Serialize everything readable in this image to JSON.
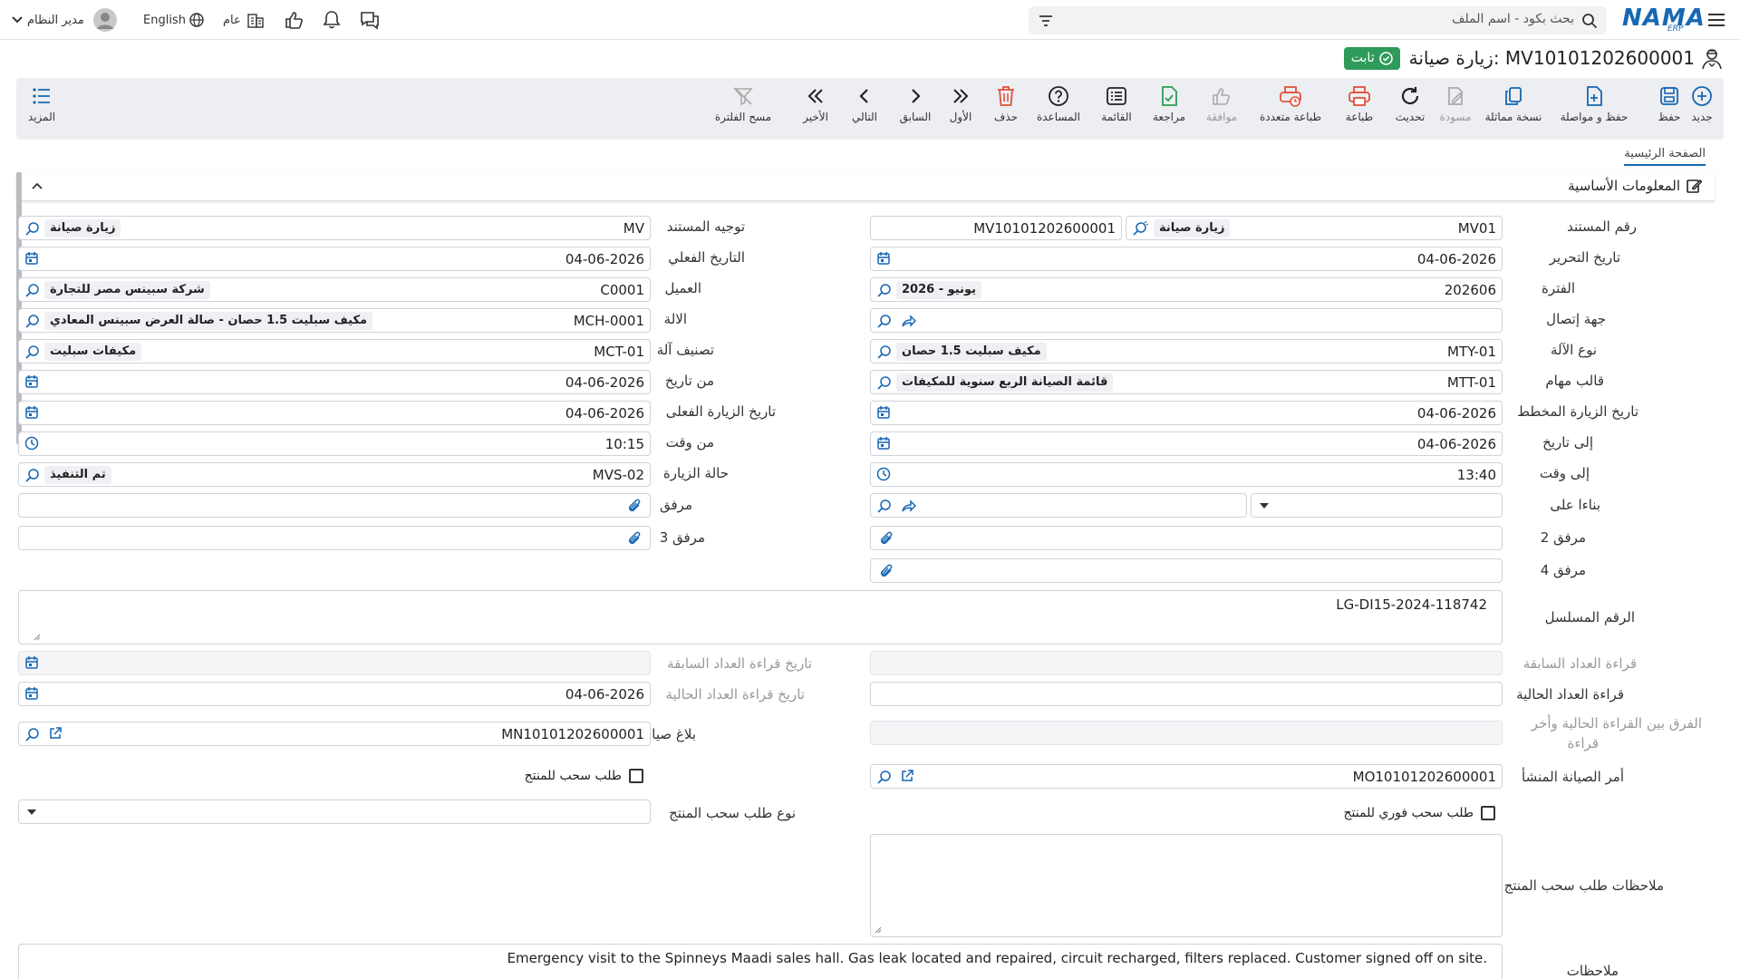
{
  "header": {
    "search_placeholder": "بحث بكود - اسم الملف",
    "user_name": "مدير النظام",
    "language": "English",
    "scope": "عام",
    "logo_text": "NAMA",
    "logo_sub": "ERP"
  },
  "page": {
    "title": "زيارة صيانة: MV10101202600001",
    "status": "ثابت",
    "tab": "الصفحة الرئيسية",
    "section_title": "المعلومات الأساسية"
  },
  "toolbar": {
    "buttons": [
      {
        "label": "جديد",
        "icon": "plus-circle-icon"
      },
      {
        "label": "حفظ",
        "icon": "save-icon"
      },
      {
        "label": "حفظ و مواصلة",
        "icon": "save-continue-icon"
      },
      {
        "label": "نسخة مماثلة",
        "icon": "duplicate-icon"
      },
      {
        "label": "مسودة",
        "icon": "draft-icon"
      },
      {
        "label": "تحديث",
        "icon": "refresh-icon"
      },
      {
        "label": "طباعة",
        "icon": "print-icon"
      },
      {
        "label": "طباعة متعددة",
        "icon": "multi-print-icon"
      },
      {
        "label": "موافقة",
        "icon": "thumbs-up-icon"
      },
      {
        "label": "مراجعة",
        "icon": "review-icon"
      },
      {
        "label": "القائمة",
        "icon": "list-icon"
      },
      {
        "label": "المساعدة",
        "icon": "help-icon"
      },
      {
        "label": "حذف",
        "icon": "trash-icon"
      },
      {
        "label": "الأول",
        "icon": "first-icon"
      },
      {
        "label": "السابق",
        "icon": "prev-icon"
      },
      {
        "label": "التالي",
        "icon": "next-icon"
      },
      {
        "label": "الأخير",
        "icon": "last-icon"
      },
      {
        "label": "مسح الفلترة",
        "icon": "clear-filter-icon"
      },
      {
        "label": "المزيد",
        "icon": "more-icon"
      }
    ]
  },
  "form": {
    "doc_number": {
      "label": "رقم المستند",
      "code": "MV01",
      "name": "زيارة صيانة",
      "serial": "MV10101202600001"
    },
    "doc_direction": {
      "label": "توجيه المستند",
      "code": "MV",
      "name": "زيارة صيانة"
    },
    "edit_date": {
      "label": "تاريخ التحرير",
      "value": "04-06-2026"
    },
    "actual_date": {
      "label": "التاريخ الفعلي",
      "value": "04-06-2026"
    },
    "period": {
      "label": "الفترة",
      "code": "202606",
      "name": "2026 - يونيو"
    },
    "customer": {
      "label": "العميل",
      "code": "C0001",
      "name": "شركة سبينس مصر للتجارة"
    },
    "contact": {
      "label": "جهة إتصال"
    },
    "machine": {
      "label": "الالة",
      "code": "MCH-0001",
      "name": "مكيف سبليت 1.5 حصان - صالة العرض سبينس المعادي"
    },
    "machine_type": {
      "label": "نوع الآلة",
      "code": "MTY-01",
      "name": "مكيف سبليت 1.5 حصان"
    },
    "machine_class": {
      "label": "تصنيف آلة",
      "code": "MCT-01",
      "name": "مكيفات سبليت"
    },
    "task_template": {
      "label": "قالب مهام",
      "code": "MTT-01",
      "name": "قائمة الصيانة الربع سنوية للمكيفات"
    },
    "from_date": {
      "label": "من تاريخ",
      "value": "04-06-2026"
    },
    "planned_visit_date": {
      "label": "تاريخ الزيارة المخطط",
      "value": "04-06-2026"
    },
    "actual_visit_date": {
      "label": "تاريخ الزيارة الفعلى",
      "value": "04-06-2026"
    },
    "to_date": {
      "label": "إلى تاريخ",
      "value": "04-06-2026"
    },
    "from_time": {
      "label": "من وقت",
      "value": "10:15"
    },
    "to_time": {
      "label": "إلى وقت",
      "value": "13:40"
    },
    "visit_status": {
      "label": "حالة الزيارة",
      "code": "MVS-02",
      "name": "تم التنفيذ"
    },
    "based_on": {
      "label": "بناءا على"
    },
    "attachment": {
      "label": "مرفق"
    },
    "attachment2": {
      "label": "مرفق 2"
    },
    "attachment3": {
      "label": "مرفق 3"
    },
    "attachment4": {
      "label": "مرفق 4"
    },
    "serial_number": {
      "label": "الرقم المسلسل",
      "value": "LG-DI15-2024-118742"
    },
    "prev_counter": {
      "label": "قراءة العداد السابقة"
    },
    "prev_counter_date": {
      "label": "تاريخ قراءة العداد السابقة"
    },
    "cur_counter": {
      "label": "قراءة العداد الحالية"
    },
    "cur_counter_date": {
      "label": "تاريخ قراءة العداد الحالية",
      "value": "04-06-2026"
    },
    "diff": {
      "label_line1": "الفرق بين القراءة الحالية وأخر",
      "label_line2": "قراءة"
    },
    "maintenance_report": {
      "label": "بلاغ صيانة",
      "value": "MN10101202600001"
    },
    "origin_order": {
      "label": "أمر الصيانة المنشأ",
      "value": "MO10101202600001"
    },
    "pull_request": {
      "label": "طلب سحب للمنتج"
    },
    "immediate_pull": {
      "label": "طلب سحب فوري للمنتج"
    },
    "pull_type": {
      "label": "نوع طلب سحب المنتج"
    },
    "pull_notes": {
      "label": "ملاحظات طلب سحب المنتج"
    },
    "remarks": {
      "label": "ملاحظات",
      "value": "Emergency visit to the Spinneys Maadi sales hall. Gas leak located and repaired, circuit recharged, filters replaced. Customer signed off on site."
    }
  }
}
